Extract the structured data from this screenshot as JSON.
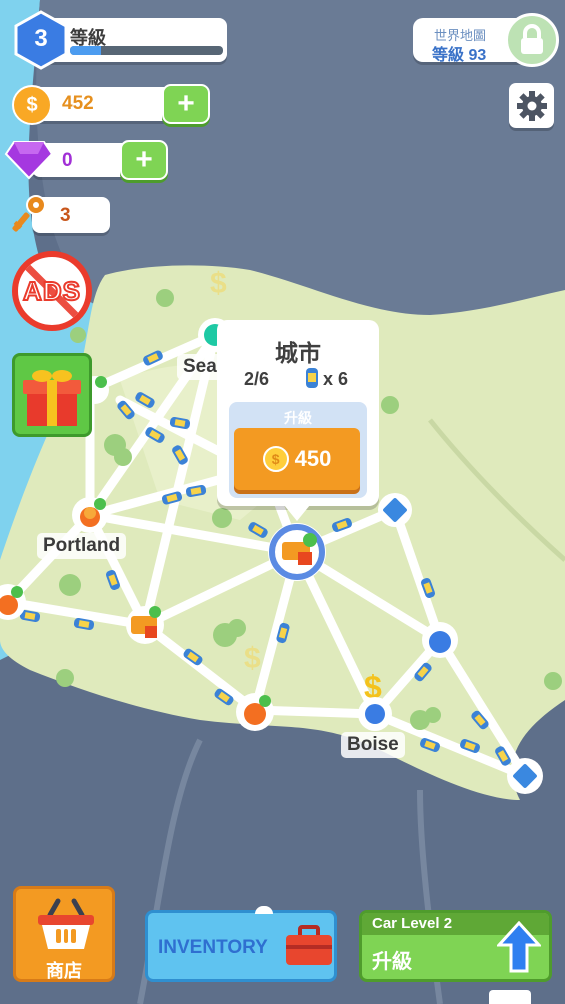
{
  "level": {
    "number": "3",
    "label": "等級",
    "progress": 0.2
  },
  "world_map": {
    "title": "世界地圖",
    "level_text": "等級 93"
  },
  "coins": {
    "value": "452"
  },
  "gems": {
    "value": "0"
  },
  "keys": {
    "value": "3"
  },
  "ads": {
    "label": "ADS"
  },
  "cities": [
    {
      "label": "Sea"
    },
    {
      "label": "Portland"
    },
    {
      "label": "Boise"
    }
  ],
  "popup": {
    "title": "城市",
    "progress": "2/6",
    "cars": "x 6",
    "upgrade_label": "升級",
    "cost": "450"
  },
  "bottom": {
    "shop_label": "商店",
    "inventory_label": "INVENTORY",
    "car_level_label": "Car Level 2",
    "car_upgrade_label": "升級"
  },
  "colors": {
    "sea": "#5e6f8a",
    "coast": "#7fd2ee",
    "land": "#dfeabc",
    "road": "#ffffff",
    "accent_orange": "#f39a22",
    "accent_green": "#7fd454",
    "accent_blue": "#3aa2ea"
  }
}
